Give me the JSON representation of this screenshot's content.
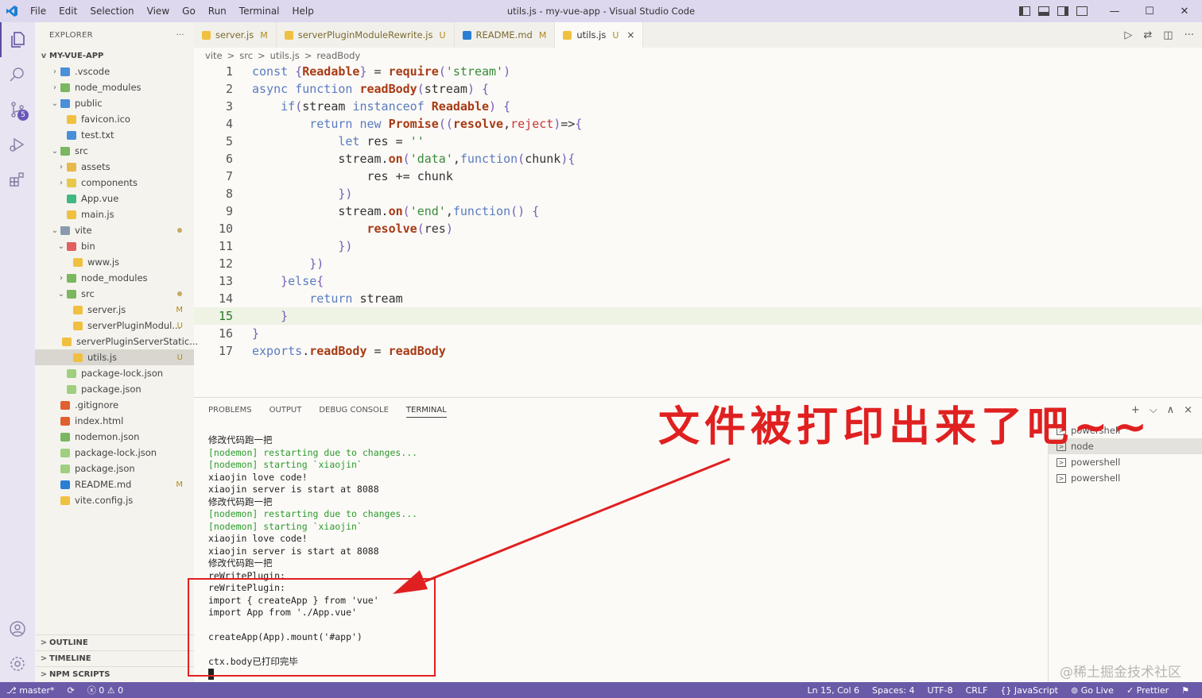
{
  "window": {
    "title": "utils.js - my-vue-app - Visual Studio Code",
    "menu": [
      "File",
      "Edit",
      "Selection",
      "View",
      "Go",
      "Run",
      "Terminal",
      "Help"
    ]
  },
  "activity": {
    "scm_badge": "5"
  },
  "explorer": {
    "title": "EXPLORER",
    "more": "···",
    "project": "MY-VUE-APP",
    "tree": [
      {
        "label": ".vscode",
        "depth": 0,
        "type": "folder",
        "color": "#4a8fd8",
        "chev": ">"
      },
      {
        "label": "node_modules",
        "depth": 0,
        "type": "folder",
        "color": "#7bb661",
        "chev": ">"
      },
      {
        "label": "public",
        "depth": 0,
        "type": "folder",
        "color": "#4a8fd8",
        "chev": "v"
      },
      {
        "label": "favicon.ico",
        "depth": 1,
        "type": "file",
        "color": "#f0c040"
      },
      {
        "label": "test.txt",
        "depth": 1,
        "type": "file",
        "color": "#4a8fd8"
      },
      {
        "label": "src",
        "depth": 0,
        "type": "folder",
        "color": "#7bb661",
        "chev": "v"
      },
      {
        "label": "assets",
        "depth": 1,
        "type": "folder",
        "color": "#e8b84a",
        "chev": ">"
      },
      {
        "label": "components",
        "depth": 1,
        "type": "folder",
        "color": "#e8c84a",
        "chev": ">"
      },
      {
        "label": "App.vue",
        "depth": 1,
        "type": "file",
        "color": "#41b883"
      },
      {
        "label": "main.js",
        "depth": 1,
        "type": "file",
        "color": "#f0c040"
      },
      {
        "label": "vite",
        "depth": 0,
        "type": "folder",
        "color": "#8a9bb0",
        "chev": "v",
        "dot": true
      },
      {
        "label": "bin",
        "depth": 1,
        "type": "folder",
        "color": "#e06060",
        "chev": "v"
      },
      {
        "label": "www.js",
        "depth": 2,
        "type": "file",
        "color": "#f0c040"
      },
      {
        "label": "node_modules",
        "depth": 1,
        "type": "folder",
        "color": "#7bb661",
        "chev": ">"
      },
      {
        "label": "src",
        "depth": 1,
        "type": "folder",
        "color": "#7bb661",
        "chev": "v",
        "dot": true
      },
      {
        "label": "server.js",
        "depth": 2,
        "type": "file",
        "color": "#f0c040",
        "mark": "M"
      },
      {
        "label": "serverPluginModul...",
        "depth": 2,
        "type": "file",
        "color": "#f0c040",
        "mark": "U"
      },
      {
        "label": "serverPluginServerStatic...",
        "depth": 2,
        "type": "file",
        "color": "#f0c040"
      },
      {
        "label": "utils.js",
        "depth": 2,
        "type": "file",
        "color": "#f0c040",
        "mark": "U",
        "selected": true
      },
      {
        "label": "package-lock.json",
        "depth": 1,
        "type": "file",
        "color": "#9fcf7f"
      },
      {
        "label": "package.json",
        "depth": 1,
        "type": "file",
        "color": "#9fcf7f"
      },
      {
        "label": ".gitignore",
        "depth": 0,
        "type": "file",
        "color": "#e06030"
      },
      {
        "label": "index.html",
        "depth": 0,
        "type": "file",
        "color": "#e06030"
      },
      {
        "label": "nodemon.json",
        "depth": 0,
        "type": "file",
        "color": "#7bb661"
      },
      {
        "label": "package-lock.json",
        "depth": 0,
        "type": "file",
        "color": "#9fcf7f"
      },
      {
        "label": "package.json",
        "depth": 0,
        "type": "file",
        "color": "#9fcf7f"
      },
      {
        "label": "README.md",
        "depth": 0,
        "type": "file",
        "color": "#2a7fd4",
        "mark": "M"
      },
      {
        "label": "vite.config.js",
        "depth": 0,
        "type": "file",
        "color": "#f0c040"
      }
    ],
    "sections": [
      "OUTLINE",
      "TIMELINE",
      "NPM SCRIPTS"
    ]
  },
  "tabs": [
    {
      "label": "server.js",
      "flag": "M",
      "color": "#f0c040"
    },
    {
      "label": "serverPluginModuleRewrite.js",
      "flag": "U",
      "color": "#f0c040"
    },
    {
      "label": "README.md",
      "flag": "M",
      "color": "#2a7fd4"
    },
    {
      "label": "utils.js",
      "flag": "U",
      "color": "#f0c040",
      "active": true,
      "close": "×"
    }
  ],
  "breadcrumb": [
    "vite",
    ">",
    "src",
    ">",
    "utils.js",
    ">",
    "readBody"
  ],
  "code_lines": [
    "const {Readable} = require('stream')",
    "async function readBody(stream) {",
    "    if(stream instanceof Readable) {",
    "        return new Promise((resolve,reject)=>{",
    "            let res = ''",
    "            stream.on('data',function(chunk){",
    "                res += chunk",
    "            })",
    "            stream.on('end',function() {",
    "                resolve(res)",
    "            })",
    "        })",
    "    }else{",
    "        return stream",
    "    }",
    "}",
    "exports.readBody = readBody"
  ],
  "panel": {
    "tabs": [
      "PROBLEMS",
      "OUTPUT",
      "DEBUG CONSOLE",
      "TERMINAL"
    ],
    "active_tab": "TERMINAL",
    "terminal_lines": [
      {
        "text": "修改代码跑一把",
        "color": "normal"
      },
      {
        "text": "[nodemon] restarting due to changes...",
        "color": "green"
      },
      {
        "text": "[nodemon] starting `xiaojin`",
        "color": "green"
      },
      {
        "text": "xiaojin love code!",
        "color": "normal"
      },
      {
        "text": "xiaojin server is start at 8088",
        "color": "normal"
      },
      {
        "text": "修改代码跑一把",
        "color": "normal"
      },
      {
        "text": "[nodemon] restarting due to changes...",
        "color": "green"
      },
      {
        "text": "[nodemon] starting `xiaojin`",
        "color": "green"
      },
      {
        "text": "xiaojin love code!",
        "color": "normal"
      },
      {
        "text": "xiaojin server is start at 8088",
        "color": "normal"
      },
      {
        "text": "修改代码跑一把",
        "color": "normal"
      },
      {
        "text": "reWritePlugin:",
        "color": "normal"
      },
      {
        "text": "reWritePlugin:",
        "color": "normal"
      },
      {
        "text": "import { createApp } from 'vue'",
        "color": "normal"
      },
      {
        "text": "import App from './App.vue'",
        "color": "normal"
      },
      {
        "text": "",
        "color": "normal"
      },
      {
        "text": "createApp(App).mount('#app')",
        "color": "normal"
      },
      {
        "text": "",
        "color": "normal"
      },
      {
        "text": "ctx.body已打印完毕",
        "color": "normal"
      }
    ],
    "terminals": [
      {
        "label": "powershell",
        "selected": false
      },
      {
        "label": "node",
        "selected": true
      },
      {
        "label": "powershell",
        "selected": false
      },
      {
        "label": "powershell",
        "selected": false
      }
    ],
    "actions": [
      "+",
      "⌵",
      "∧",
      "×"
    ]
  },
  "annotation": "文件被打印出来了吧~~",
  "watermark": "@稀土掘金技术社区",
  "status": {
    "branch": "master*",
    "sync": "⟳",
    "errors": "0",
    "warnings": "0",
    "position": "Ln 15, Col 6",
    "spaces": "Spaces: 4",
    "encoding": "UTF-8",
    "eol": "CRLF",
    "language": "JavaScript",
    "golive": "Go Live",
    "prettier": "Prettier"
  }
}
